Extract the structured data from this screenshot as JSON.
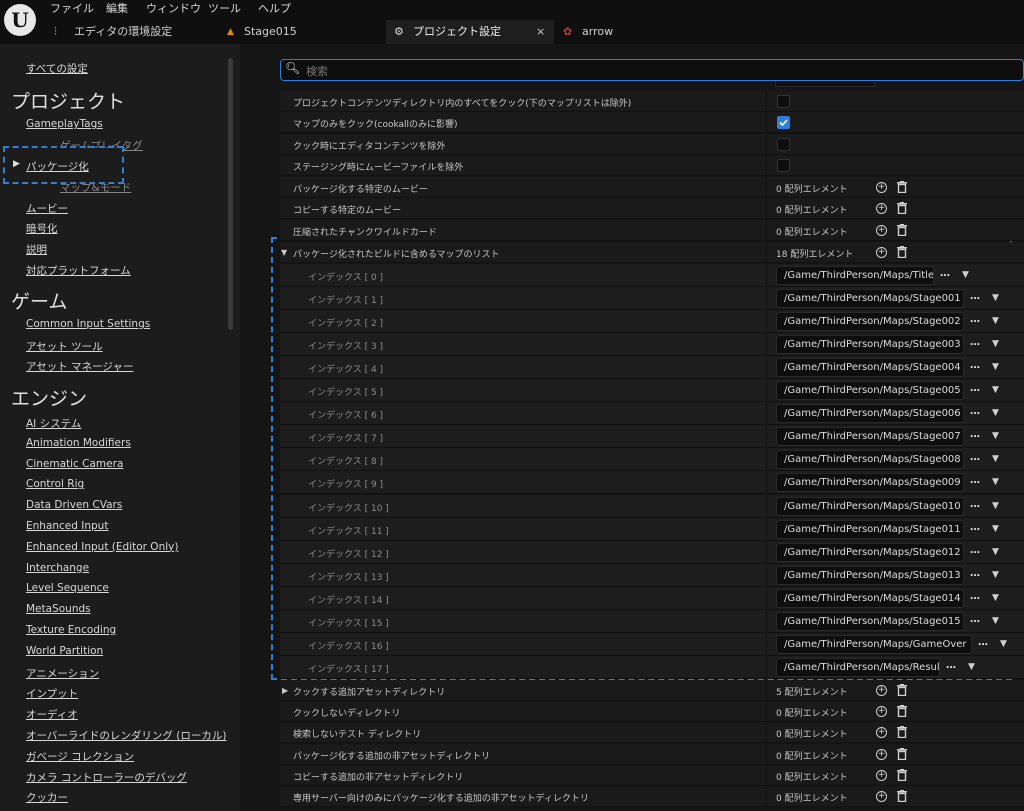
{
  "menubar": {
    "items": [
      "ファイル",
      "編集",
      "ウィンドウ",
      "ツール",
      "ヘルプ"
    ],
    "tabs": [
      {
        "label": "エディタの環境設定"
      },
      {
        "label": "Stage015"
      },
      {
        "label": "プロジェクト設定"
      },
      {
        "label": "arrow"
      }
    ]
  },
  "sidebar": {
    "all_settings": "すべての設定",
    "project_header": "プロジェクト",
    "gameplay_tags": "GameplayTags",
    "occluded_item": "ゲームプレイタグ",
    "package": "パッケージ化",
    "occluded_item2": "マップ&モード",
    "movie": "ムービー",
    "encryption": "暗号化",
    "description": "説明",
    "platforms": "対応プラットフォーム",
    "game_header": "ゲーム",
    "game_items": [
      "Common Input Settings",
      "アセット ツール",
      "アセット マネージャー"
    ],
    "engine_header": "エンジン",
    "engine_items": [
      "AI システム",
      "Animation Modifiers",
      "Cinematic Camera",
      "Control Rig",
      "Data Driven CVars",
      "Enhanced Input",
      "Enhanced Input (Editor Only)",
      "Interchange",
      "Level Sequence",
      "MetaSounds",
      "Texture Encoding",
      "World Partition",
      "アニメーション",
      "インプット",
      "オーディオ",
      "オーバーライドのレンダリング (ローカル)",
      "ガベージ コレクション",
      "カメラ コントローラーのデバッグ",
      "クッカー"
    ]
  },
  "search": {
    "placeholder": "検索"
  },
  "settings_top": [
    {
      "label": "プロジェクトコンテンツディレクトリ内のすべてをクック(下のマップリストは除外)",
      "checked": false
    },
    {
      "label": "マップのみをクック(cookallのみに影響)",
      "checked": true
    },
    {
      "label": "クック時にエディタコンテンツを除外",
      "checked": false
    },
    {
      "label": "ステージング時にムービーファイルを除外",
      "checked": false
    }
  ],
  "array_rows_top": [
    {
      "label": "パッケージ化する特定のムービー",
      "count": "0 配列エレメント"
    },
    {
      "label": "コピーする特定のムービー",
      "count": "0 配列エレメント"
    },
    {
      "label": "圧縮されたチャンクワイルドカード",
      "count": "0 配列エレメント"
    }
  ],
  "maps_list": {
    "label": "パッケージ化されたビルドに含めるマップのリスト",
    "count": "18 配列エレメント",
    "entries": [
      {
        "index": "インデックス [ 0 ]",
        "path": "/Game/ThirdPerson/Maps/Title"
      },
      {
        "index": "インデックス [ 1 ]",
        "path": "/Game/ThirdPerson/Maps/Stage001"
      },
      {
        "index": "インデックス [ 2 ]",
        "path": "/Game/ThirdPerson/Maps/Stage002"
      },
      {
        "index": "インデックス [ 3 ]",
        "path": "/Game/ThirdPerson/Maps/Stage003"
      },
      {
        "index": "インデックス [ 4 ]",
        "path": "/Game/ThirdPerson/Maps/Stage004"
      },
      {
        "index": "インデックス [ 5 ]",
        "path": "/Game/ThirdPerson/Maps/Stage005"
      },
      {
        "index": "インデックス [ 6 ]",
        "path": "/Game/ThirdPerson/Maps/Stage006"
      },
      {
        "index": "インデックス [ 7 ]",
        "path": "/Game/ThirdPerson/Maps/Stage007"
      },
      {
        "index": "インデックス [ 8 ]",
        "path": "/Game/ThirdPerson/Maps/Stage008"
      },
      {
        "index": "インデックス [ 9 ]",
        "path": "/Game/ThirdPerson/Maps/Stage009"
      },
      {
        "index": "インデックス [ 10 ]",
        "path": "/Game/ThirdPerson/Maps/Stage010"
      },
      {
        "index": "インデックス [ 11 ]",
        "path": "/Game/ThirdPerson/Maps/Stage011"
      },
      {
        "index": "インデックス [ 12 ]",
        "path": "/Game/ThirdPerson/Maps/Stage012"
      },
      {
        "index": "インデックス [ 13 ]",
        "path": "/Game/ThirdPerson/Maps/Stage013"
      },
      {
        "index": "インデックス [ 14 ]",
        "path": "/Game/ThirdPerson/Maps/Stage014"
      },
      {
        "index": "インデックス [ 15 ]",
        "path": "/Game/ThirdPerson/Maps/Stage015"
      },
      {
        "index": "インデックス [ 16 ]",
        "path": "/Game/ThirdPerson/Maps/GameOver"
      },
      {
        "index": "インデックス [ 17 ]",
        "path": "/Game/ThirdPerson/Maps/Result"
      }
    ]
  },
  "array_rows_bottom": [
    {
      "label": "クックする追加アセットディレクトリ",
      "count": "5 配列エレメント"
    },
    {
      "label": "クックしないディレクトリ",
      "count": "0 配列エレメント"
    },
    {
      "label": "検索しないテスト ディレクトリ",
      "count": "0 配列エレメント"
    },
    {
      "label": "パッケージ化する追加の非アセットディレクトリ",
      "count": "0 配列エレメント"
    },
    {
      "label": "コピーする追加の非アセットディレクトリ",
      "count": "0 配列エレメント"
    },
    {
      "label": "専用サーバー向けのみにパッケージ化する追加の非アセットディレクトリ",
      "count": "0 配列エレメント"
    }
  ],
  "colors": {
    "accent": "#2f7fd6",
    "checkbox_checked": "#2f7fd6"
  }
}
